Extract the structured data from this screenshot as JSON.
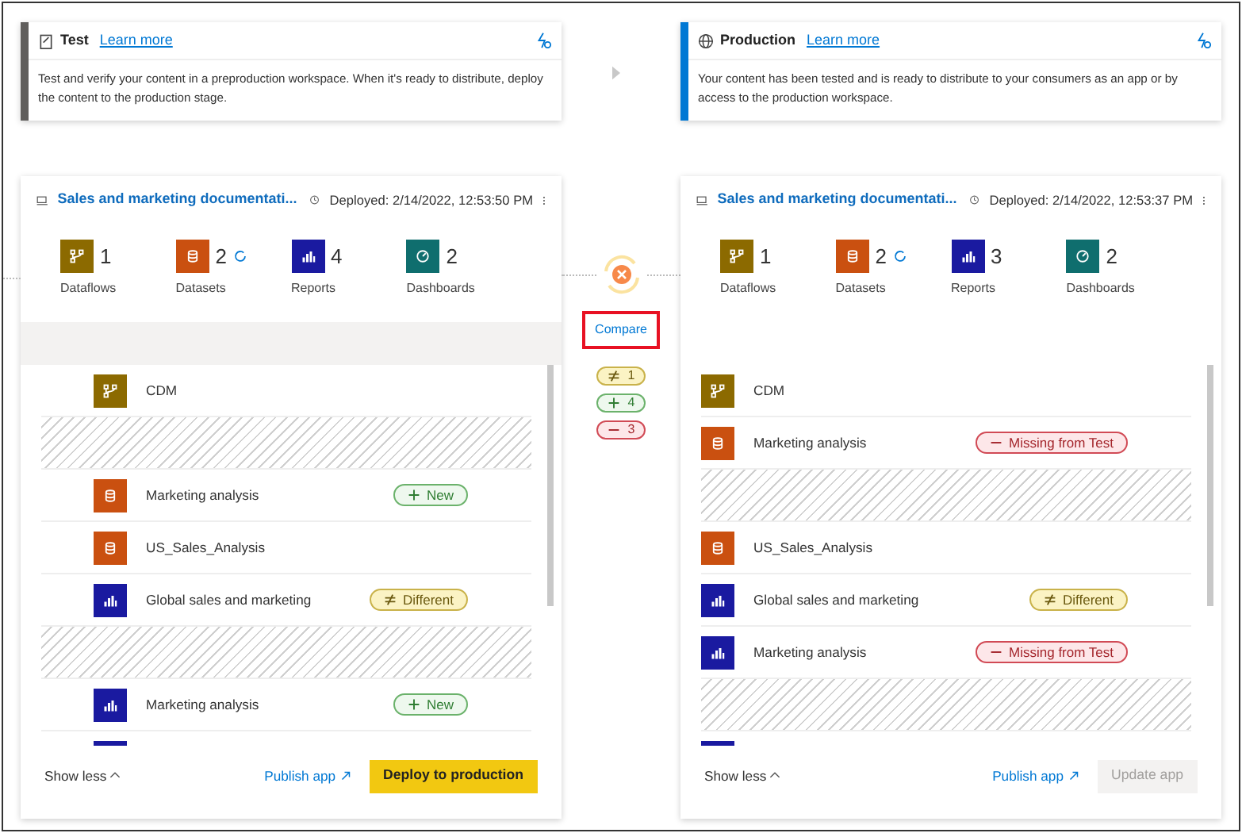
{
  "stages": [
    {
      "name": "Test",
      "kind": "test",
      "color": "#605e5c",
      "link": "Learn more",
      "description": "Test and verify your content in a preproduction workspace. When it's ready to distribute, deploy the content to the production stage.",
      "pipeline": {
        "title": "Sales and marketing documentati...",
        "deployed": "Deployed: 2/14/2022, 12:53:50 PM",
        "counts": [
          {
            "kind": "dataflow",
            "value": "1",
            "label": "Dataflows"
          },
          {
            "kind": "dataset",
            "value": "2",
            "label": "Datasets",
            "refreshing": true
          },
          {
            "kind": "report",
            "value": "4",
            "label": "Reports"
          },
          {
            "kind": "dashboard",
            "value": "2",
            "label": "Dashboards"
          }
        ],
        "list_header": true,
        "items": [
          {
            "kind": "dataflow",
            "name": "CDM"
          },
          {
            "kind": "gap"
          },
          {
            "kind": "dataset",
            "name": "Marketing analysis",
            "badge": {
              "kind": "new",
              "label": "New"
            }
          },
          {
            "kind": "dataset",
            "name": "US_Sales_Analysis"
          },
          {
            "kind": "report",
            "name": "Global sales and marketing",
            "badge": {
              "kind": "different",
              "label": "Different"
            }
          },
          {
            "kind": "gap"
          },
          {
            "kind": "report",
            "name": "Marketing analysis",
            "badge": {
              "kind": "new",
              "label": "New"
            }
          },
          {
            "kind": "report"
          }
        ],
        "show_less": "Show less",
        "publish": "Publish app",
        "action": {
          "label": "Deploy to production",
          "disabled": false
        }
      }
    },
    {
      "name": "Production",
      "kind": "production",
      "color": "#0078d4",
      "link": "Learn more",
      "description": "Your content has been tested and is ready to distribute to your consumers as an app or by access to the production workspace.",
      "pipeline": {
        "title": "Sales and marketing documentati...",
        "deployed": "Deployed: 2/14/2022, 12:53:37 PM",
        "counts": [
          {
            "kind": "dataflow",
            "value": "1",
            "label": "Dataflows"
          },
          {
            "kind": "dataset",
            "value": "2",
            "label": "Datasets",
            "refreshing": true
          },
          {
            "kind": "report",
            "value": "3",
            "label": "Reports"
          },
          {
            "kind": "dashboard",
            "value": "2",
            "label": "Dashboards"
          }
        ],
        "list_header": false,
        "items": [
          {
            "kind": "dataflow",
            "name": "CDM"
          },
          {
            "kind": "dataset",
            "name": "Marketing analysis",
            "badge": {
              "kind": "missing",
              "label": "Missing from Test"
            }
          },
          {
            "kind": "gap"
          },
          {
            "kind": "dataset",
            "name": "US_Sales_Analysis"
          },
          {
            "kind": "report",
            "name": "Global sales and marketing",
            "badge": {
              "kind": "different",
              "label": "Different"
            }
          },
          {
            "kind": "report",
            "name": "Marketing analysis",
            "badge": {
              "kind": "missing",
              "label": "Missing from Test"
            }
          },
          {
            "kind": "gap"
          },
          {
            "kind": "report"
          }
        ],
        "show_less": "Show less",
        "publish": "Publish app",
        "action": {
          "label": "Update app",
          "disabled": true
        }
      }
    }
  ],
  "compare": {
    "link": "Compare",
    "summary": [
      {
        "kind": "different",
        "value": "1"
      },
      {
        "kind": "new",
        "value": "4"
      },
      {
        "kind": "missing",
        "value": "3"
      }
    ]
  }
}
